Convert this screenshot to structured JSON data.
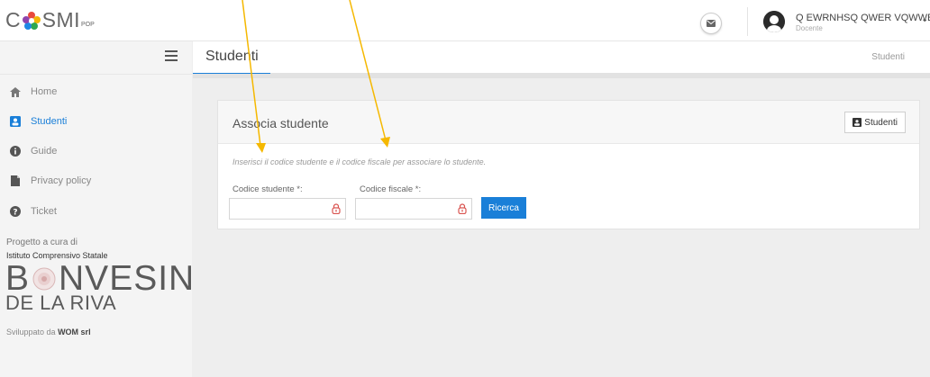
{
  "header": {
    "logo_prefix": "C",
    "logo_name": "SMI",
    "logo_suffix": "POP",
    "user_name": "Q EWRNHSQ QWER VQWWER",
    "user_role": "Docente"
  },
  "sidebar": {
    "items": [
      {
        "label": "Home",
        "icon": "home-icon"
      },
      {
        "label": "Studenti",
        "icon": "student-icon",
        "active": true
      },
      {
        "label": "Guide",
        "icon": "info-icon"
      },
      {
        "label": "Privacy policy",
        "icon": "document-icon"
      },
      {
        "label": "Ticket",
        "icon": "help-icon"
      }
    ],
    "project_by": "Progetto a cura di",
    "school_name": "Istituto Comprensivo Statale",
    "logo_line1_a": "B",
    "logo_line1_b": "NVESIN",
    "logo_line2": "DE LA RIVA",
    "developed_by": "Sviluppato da",
    "developer": "WOM srl"
  },
  "page": {
    "title": "Studenti",
    "breadcrumb": "Studenti"
  },
  "card": {
    "title": "Associa studente",
    "button_label": "Studenti",
    "hint": "Inserisci il codice studente e il codice fiscale per associare lo studente.",
    "field1_label": "Codice studente *:",
    "field1_value": "",
    "field2_label": "Codice fiscale *:",
    "field2_value": "",
    "search_label": "Ricerca"
  },
  "colors": {
    "accent": "#1a7fd8",
    "annotation_arrow": "#f5b800",
    "lock": "#d9534f"
  }
}
